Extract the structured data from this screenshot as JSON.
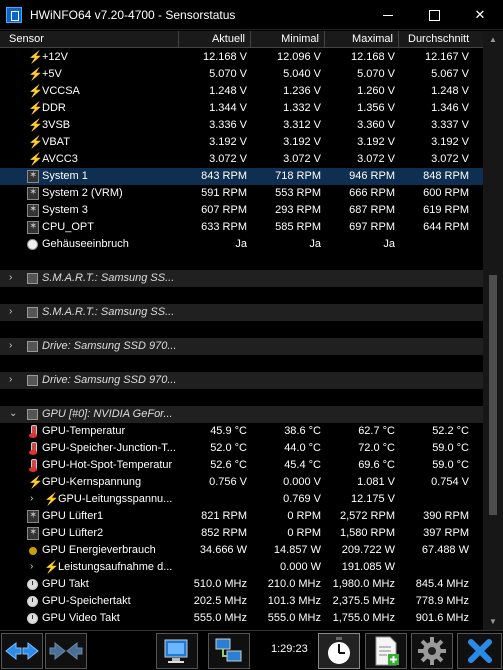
{
  "window": {
    "title": "HWiNFO64 v7.20-4700 - Sensorstatus"
  },
  "columns": {
    "sensor": "Sensor",
    "current": "Aktuell",
    "min": "Minimal",
    "max": "Maximal",
    "avg": "Durchschnitt"
  },
  "rows": [
    {
      "kind": "sensor",
      "icon": "lightning-icon",
      "label": "+12V",
      "cur": "12.168 V",
      "min": "12.096 V",
      "max": "12.168 V",
      "avg": "12.167 V"
    },
    {
      "kind": "sensor",
      "icon": "lightning-icon",
      "label": "+5V",
      "cur": "5.070 V",
      "min": "5.040 V",
      "max": "5.070 V",
      "avg": "5.067 V"
    },
    {
      "kind": "sensor",
      "icon": "lightning-icon",
      "label": "VCCSA",
      "cur": "1.248 V",
      "min": "1.236 V",
      "max": "1.260 V",
      "avg": "1.248 V"
    },
    {
      "kind": "sensor",
      "icon": "lightning-icon",
      "label": "DDR",
      "cur": "1.344 V",
      "min": "1.332 V",
      "max": "1.356 V",
      "avg": "1.346 V"
    },
    {
      "kind": "sensor",
      "icon": "lightning-icon",
      "label": "3VSB",
      "cur": "3.336 V",
      "min": "3.312 V",
      "max": "3.360 V",
      "avg": "3.337 V"
    },
    {
      "kind": "sensor",
      "icon": "lightning-icon",
      "label": "VBAT",
      "cur": "3.192 V",
      "min": "3.192 V",
      "max": "3.192 V",
      "avg": "3.192 V"
    },
    {
      "kind": "sensor",
      "icon": "lightning-icon",
      "label": "AVCC3",
      "cur": "3.072 V",
      "min": "3.072 V",
      "max": "3.072 V",
      "avg": "3.072 V"
    },
    {
      "kind": "sensor",
      "icon": "fan-icon",
      "label": "System 1",
      "cur": "843 RPM",
      "min": "718 RPM",
      "max": "946 RPM",
      "avg": "848 RPM",
      "selected": true
    },
    {
      "kind": "sensor",
      "icon": "fan-icon",
      "label": "System 2 (VRM)",
      "cur": "591 RPM",
      "min": "553 RPM",
      "max": "666 RPM",
      "avg": "600 RPM"
    },
    {
      "kind": "sensor",
      "icon": "fan-icon",
      "label": "System 3",
      "cur": "607 RPM",
      "min": "293 RPM",
      "max": "687 RPM",
      "avg": "619 RPM"
    },
    {
      "kind": "sensor",
      "icon": "fan-icon",
      "label": "CPU_OPT",
      "cur": "633 RPM",
      "min": "585 RPM",
      "max": "697 RPM",
      "avg": "644 RPM"
    },
    {
      "kind": "sensor",
      "icon": "intrusion-icon",
      "label": "Gehäuseeinbruch",
      "cur": "Ja",
      "min": "Ja",
      "max": "Ja",
      "avg": ""
    },
    {
      "kind": "spacer"
    },
    {
      "kind": "group",
      "label": "S.M.A.R.T.: Samsung SS...",
      "expanded": false
    },
    {
      "kind": "spacer"
    },
    {
      "kind": "group",
      "label": "S.M.A.R.T.: Samsung SS...",
      "expanded": false
    },
    {
      "kind": "spacer"
    },
    {
      "kind": "group",
      "label": "Drive: Samsung SSD 970...",
      "expanded": false
    },
    {
      "kind": "spacer"
    },
    {
      "kind": "group",
      "label": "Drive: Samsung SSD 970...",
      "expanded": false
    },
    {
      "kind": "spacer"
    },
    {
      "kind": "group",
      "label": "GPU [#0]: NVIDIA GeFor...",
      "expanded": true
    },
    {
      "kind": "sensor",
      "icon": "thermometer-icon",
      "label": "GPU-Temperatur",
      "cur": "45.9 °C",
      "min": "38.6 °C",
      "max": "62.7 °C",
      "avg": "52.2 °C"
    },
    {
      "kind": "sensor",
      "icon": "thermometer-icon",
      "label": "GPU-Speicher-Junction-T...",
      "cur": "52.0 °C",
      "min": "44.0 °C",
      "max": "72.0 °C",
      "avg": "59.0 °C"
    },
    {
      "kind": "sensor",
      "icon": "thermometer-icon",
      "label": "GPU-Hot-Spot-Temperatur",
      "cur": "52.6 °C",
      "min": "45.4 °C",
      "max": "69.6 °C",
      "avg": "59.0 °C"
    },
    {
      "kind": "sensor",
      "icon": "lightning-icon",
      "label": "GPU-Kernspannung",
      "cur": "0.756 V",
      "min": "0.000 V",
      "max": "1.081 V",
      "avg": "0.754 V"
    },
    {
      "kind": "sensor",
      "icon": "lightning-icon",
      "sub": true,
      "expander": true,
      "label": "GPU-Leitungsspannu...",
      "cur": "",
      "min": "0.769 V",
      "max": "12.175 V",
      "avg": ""
    },
    {
      "kind": "sensor",
      "icon": "fan-icon",
      "label": "GPU Lüfter1",
      "cur": "821 RPM",
      "min": "0 RPM",
      "max": "2,572 RPM",
      "avg": "390 RPM"
    },
    {
      "kind": "sensor",
      "icon": "fan-icon",
      "label": "GPU Lüfter2",
      "cur": "852 RPM",
      "min": "0 RPM",
      "max": "1,580 RPM",
      "avg": "397 RPM"
    },
    {
      "kind": "sensor",
      "icon": "plug-icon",
      "label": "GPU Energieverbrauch",
      "cur": "34.666 W",
      "min": "14.857 W",
      "max": "209.722 W",
      "avg": "67.488 W"
    },
    {
      "kind": "sensor",
      "icon": "lightning-icon",
      "sub": true,
      "expander": true,
      "label": "Leistungsaufnahme d...",
      "cur": "",
      "min": "0.000 W",
      "max": "191.085 W",
      "avg": ""
    },
    {
      "kind": "sensor",
      "icon": "clock-icon",
      "label": "GPU Takt",
      "cur": "510.0 MHz",
      "min": "210.0 MHz",
      "max": "1,980.0 MHz",
      "avg": "845.4 MHz"
    },
    {
      "kind": "sensor",
      "icon": "clock-icon",
      "label": "GPU-Speichertakt",
      "cur": "202.5 MHz",
      "min": "101.3 MHz",
      "max": "2,375.5 MHz",
      "avg": "778.9 MHz"
    },
    {
      "kind": "sensor",
      "icon": "clock-icon",
      "label": "GPU Video Takt",
      "cur": "555.0 MHz",
      "min": "555.0 MHz",
      "max": "1,755.0 MHz",
      "avg": "901.6 MHz"
    }
  ],
  "toolbar": {
    "elapsed_time": "1:29:23"
  },
  "colors": {
    "selection": "#0f2f52",
    "accent_blue": "#1e7be6",
    "close_red": "#e81123"
  }
}
